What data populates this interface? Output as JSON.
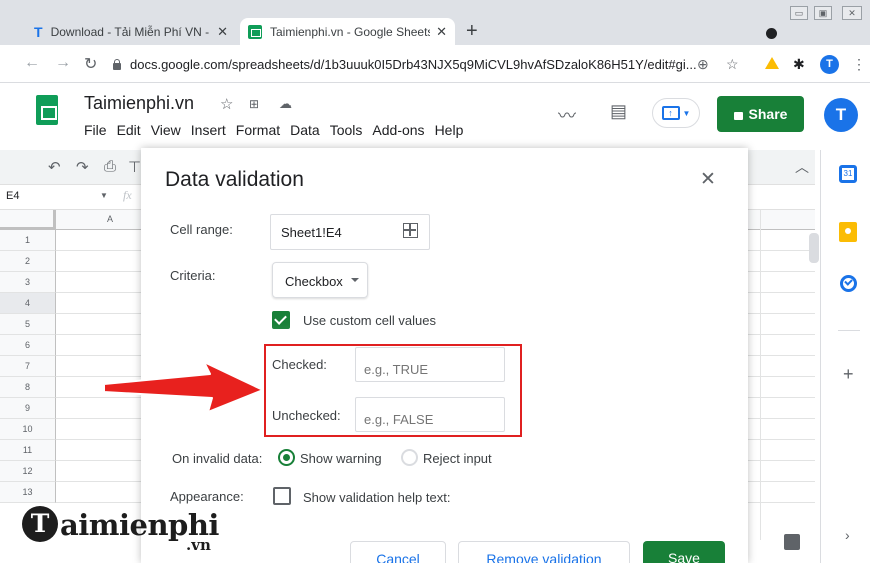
{
  "browser": {
    "tabs": [
      {
        "title": "Download - Tải Miễn Phí VN - Ph",
        "favicon": "taimienphi-t-icon"
      },
      {
        "title": "Taimienphi.vn - Google Sheets",
        "favicon": "google-sheets-icon"
      }
    ],
    "url": "docs.google.com/spreadsheets/d/1b3uuuk0I5Drb43NJX5q9MiCVL9hvAfSDzaloK86H51Y/edit#gi...",
    "profile_initial": "T"
  },
  "sheets": {
    "doc_title": "Taimienphi.vn",
    "menu": [
      "File",
      "Edit",
      "View",
      "Insert",
      "Format",
      "Data",
      "Tools",
      "Add-ons",
      "Help"
    ],
    "share_label": "Share",
    "user_initial": "T",
    "namebox": "E4",
    "fx_symbol": "fx",
    "column_a": "A",
    "rows": [
      "1",
      "2",
      "3",
      "4",
      "5",
      "6",
      "7",
      "8",
      "9",
      "10",
      "11",
      "12",
      "13"
    ],
    "selected_row": "4"
  },
  "dialog": {
    "title": "Data validation",
    "cell_range_label": "Cell range:",
    "cell_range_value": "Sheet1!E4",
    "criteria_label": "Criteria:",
    "criteria_value": "Checkbox",
    "custom_values_label": "Use custom cell values",
    "custom_values_checked": true,
    "checked_label": "Checked:",
    "checked_placeholder": "e.g., TRUE",
    "unchecked_label": "Unchecked:",
    "unchecked_placeholder": "e.g., FALSE",
    "invalid_label": "On invalid data:",
    "show_warning_label": "Show warning",
    "reject_input_label": "Reject input",
    "invalid_selected": "Show warning",
    "appearance_label": "Appearance:",
    "help_text_label": "Show validation help text:",
    "cancel_label": "Cancel",
    "remove_label": "Remove validation",
    "save_label": "Save"
  },
  "watermark": {
    "logo_letter": "T",
    "text": "aimienphi",
    "suffix": ".vn"
  },
  "colors": {
    "accent_green": "#188038",
    "highlight_red": "#e02020",
    "link_blue": "#1a73e8"
  }
}
